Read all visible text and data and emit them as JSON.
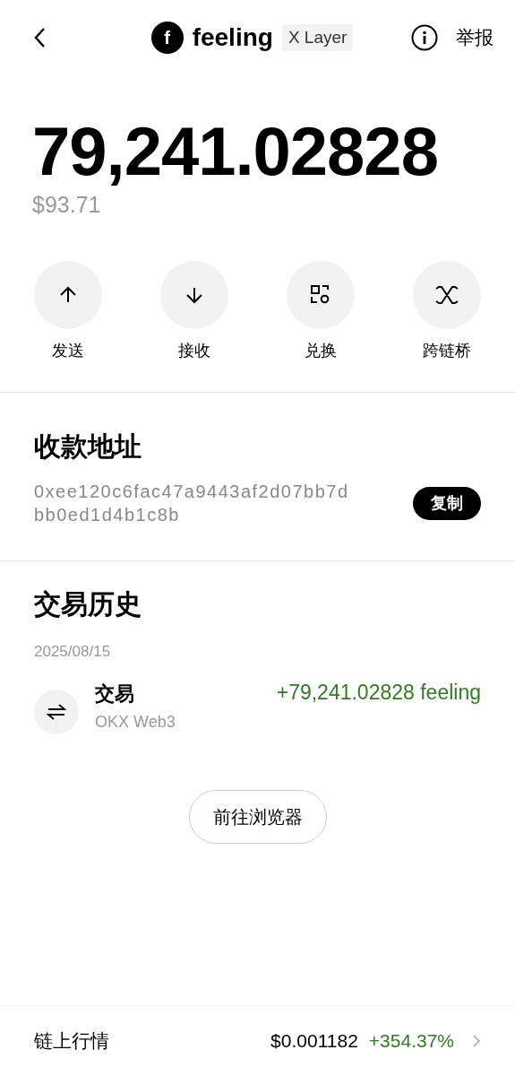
{
  "header": {
    "token_initial": "f",
    "token_name": "feeling",
    "network": "X Layer",
    "report": "举报"
  },
  "balance": {
    "amount": "79,241.02828",
    "fiat": "$93.71"
  },
  "actions": [
    {
      "kind": "send",
      "label": "发送"
    },
    {
      "kind": "receive",
      "label": "接收"
    },
    {
      "kind": "swap",
      "label": "兑换"
    },
    {
      "kind": "bridge",
      "label": "跨链桥"
    }
  ],
  "address": {
    "title": "收款地址",
    "value": "0xee120c6fac47a9443af2d07bb7dbb0ed1d4b1c8b",
    "copy": "复制"
  },
  "history": {
    "title": "交易历史",
    "date": "2025/08/15",
    "transactions": [
      {
        "title": "交易",
        "source": "OKX Web3",
        "amount": "+79,241.02828 feeling"
      }
    ],
    "explorer": "前往浏览器"
  },
  "market": {
    "label": "链上行情",
    "price": "$0.001182",
    "change": "+354.37%"
  }
}
